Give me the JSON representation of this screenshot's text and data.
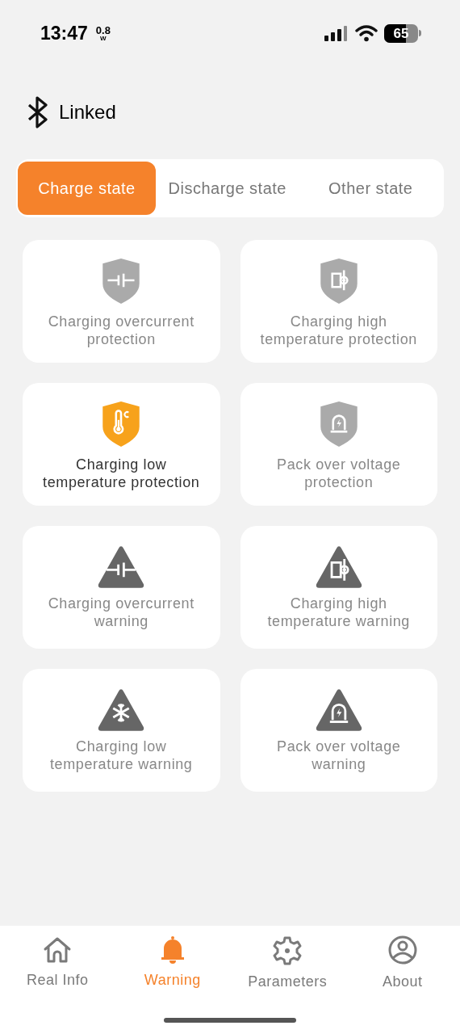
{
  "status_bar": {
    "time": "13:47",
    "rate": "0.8",
    "rate_unit": "W",
    "battery": "65"
  },
  "connection": {
    "label": "Linked"
  },
  "tabs": [
    {
      "label": "Charge state",
      "selected": true
    },
    {
      "label": "Discharge state",
      "selected": false
    },
    {
      "label": "Other state",
      "selected": false
    }
  ],
  "cards": [
    {
      "kind": "protection",
      "label": "Charging overcurrent protection",
      "active": false
    },
    {
      "kind": "protection",
      "label": "Charging high temperature protection",
      "active": false
    },
    {
      "kind": "protection",
      "label": "Charging low temperature protection",
      "active": true
    },
    {
      "kind": "protection",
      "label": "Pack over voltage protection",
      "active": false
    },
    {
      "kind": "warning",
      "label": "Charging overcurrent warning",
      "active": false
    },
    {
      "kind": "warning",
      "label": "Charging high temperature warning",
      "active": false
    },
    {
      "kind": "warning",
      "label": "Charging low temperature warning",
      "active": false
    },
    {
      "kind": "warning",
      "label": "Pack over voltage warning",
      "active": false
    }
  ],
  "nav": [
    {
      "label": "Real Info",
      "selected": false
    },
    {
      "label": "Warning",
      "selected": true
    },
    {
      "label": "Parameters",
      "selected": false
    },
    {
      "label": "About",
      "selected": false
    }
  ]
}
